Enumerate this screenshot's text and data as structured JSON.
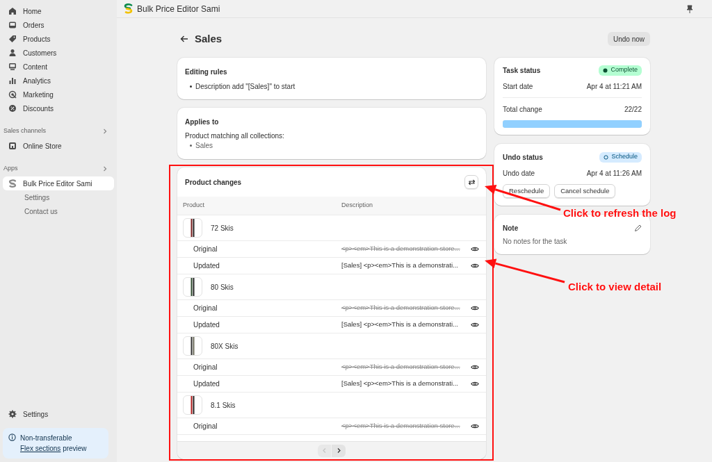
{
  "sidebar": {
    "nav": [
      {
        "label": "Home",
        "selected": false
      },
      {
        "label": "Orders",
        "selected": false
      },
      {
        "label": "Products",
        "selected": false
      },
      {
        "label": "Customers",
        "selected": false
      },
      {
        "label": "Content",
        "selected": false
      },
      {
        "label": "Analytics",
        "selected": false
      },
      {
        "label": "Marketing",
        "selected": false
      },
      {
        "label": "Discounts",
        "selected": false
      }
    ],
    "sections": [
      {
        "title": "Sales channels",
        "items": [
          {
            "label": "Online Store",
            "selected": false
          }
        ]
      },
      {
        "title": "Apps",
        "items": [
          {
            "label": "Bulk Price Editor Sami",
            "selected": true,
            "children": [
              {
                "label": "Settings"
              },
              {
                "label": "Contact us"
              }
            ]
          }
        ]
      }
    ],
    "settings": "Settings",
    "notice": {
      "title": "Non-transferable",
      "link": "Flex sections",
      "after": " preview"
    }
  },
  "top_bar": {
    "title": "Bulk Price Editor Sami"
  },
  "page": {
    "title": "Sales",
    "undo_button": "Undo now"
  },
  "editing_rules": {
    "title": "Editing rules",
    "items": [
      "Description add \"[Sales]\" to start"
    ]
  },
  "applies_to": {
    "title": "Applies to",
    "text": "Product matching all collections:",
    "items": [
      "Sales"
    ]
  },
  "product_changes": {
    "title": "Product changes",
    "columns": [
      "Product",
      "Description"
    ],
    "products": [
      {
        "name": "72 Skis",
        "changes": [
          {
            "label": "Original",
            "value": "<p><em>This is a demonstration store...",
            "struck": true
          },
          {
            "label": "Updated",
            "value": "[Sales] <p><em>This is a demonstrati...",
            "struck": false
          }
        ]
      },
      {
        "name": "80 Skis",
        "changes": [
          {
            "label": "Original",
            "value": "<p><em>This is a demonstration store...",
            "struck": true
          },
          {
            "label": "Updated",
            "value": "[Sales] <p><em>This is a demonstrati...",
            "struck": false
          }
        ]
      },
      {
        "name": "80X Skis",
        "changes": [
          {
            "label": "Original",
            "value": "<p><em>This is a demonstration store...",
            "struck": true
          },
          {
            "label": "Updated",
            "value": "[Sales] <p><em>This is a demonstrati...",
            "struck": false
          }
        ]
      },
      {
        "name": "8.1 Skis",
        "changes": [
          {
            "label": "Original",
            "value": "<p><em>This is a demonstration store...",
            "struck": true
          }
        ]
      }
    ],
    "pagination": {
      "previous_disabled": true,
      "next_disabled": false
    }
  },
  "task_status": {
    "title": "Task status",
    "badge": {
      "label": "Complete",
      "kind": "success"
    },
    "rows": [
      {
        "label": "Start date",
        "value": "Apr 4 at 11:21 AM"
      },
      {
        "label": "Total change",
        "value": "22/22"
      }
    ],
    "level": 1
  },
  "undo_status": {
    "title": "Undo status",
    "badge": {
      "label": "Schedule",
      "kind": "info"
    },
    "rows": [
      {
        "label": "Undo date",
        "value": "Apr 4 at 11:26 AM"
      }
    ],
    "buttons": [
      "Reschedule",
      "Cancel schedule"
    ]
  },
  "note": {
    "title": "Note",
    "text": "No notes for the task"
  },
  "annotations": [
    {
      "text": "Click to refresh the log"
    },
    {
      "text": "Click to view detail"
    }
  ]
}
